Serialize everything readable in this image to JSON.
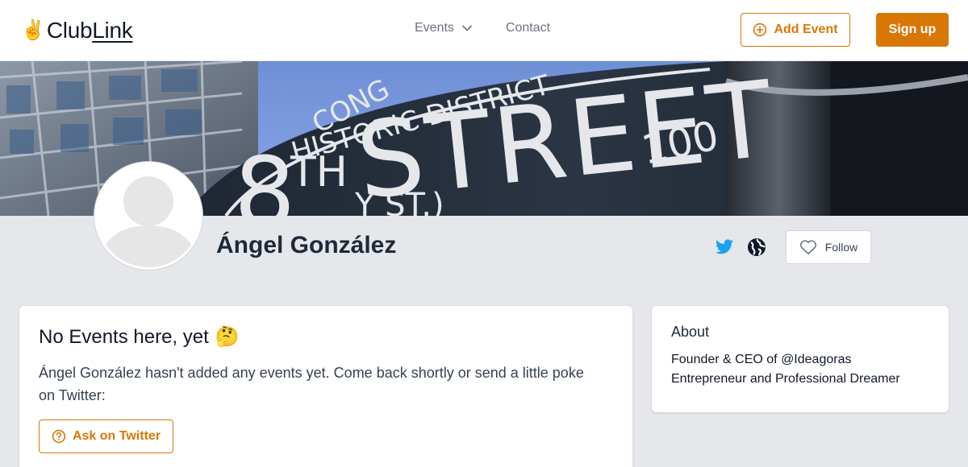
{
  "header": {
    "logo_hand": "✌️",
    "logo_club": "Club",
    "logo_link": "Link",
    "nav_events": "Events",
    "nav_contact": "Contact",
    "add_event_label": "Add Event",
    "signup_label": "Sign up"
  },
  "banner": {
    "sign_top": "CONG",
    "sign_district": "HISTORIC DISTRICT",
    "sign_number_prefix": "8",
    "sign_number_suffix": "TH",
    "sign_street": "STREET",
    "sign_block": "100",
    "sign_sub": "Y ST.)"
  },
  "profile": {
    "name": "Ángel González",
    "follow_label": "Follow"
  },
  "events_card": {
    "title": "No Events here, yet",
    "title_emoji": "🤔",
    "text": "Ángel González hasn't added any events yet. Come back shortly or send a little poke on Twitter:",
    "ask_label": "Ask on Twitter"
  },
  "about_card": {
    "title": "About",
    "text": "Founder & CEO of @Ideagoras Entrepreneur and Professional Dreamer"
  },
  "colors": {
    "accent": "#d97706",
    "twitter": "#1da1f2",
    "page_bg": "#e5e7eb"
  }
}
